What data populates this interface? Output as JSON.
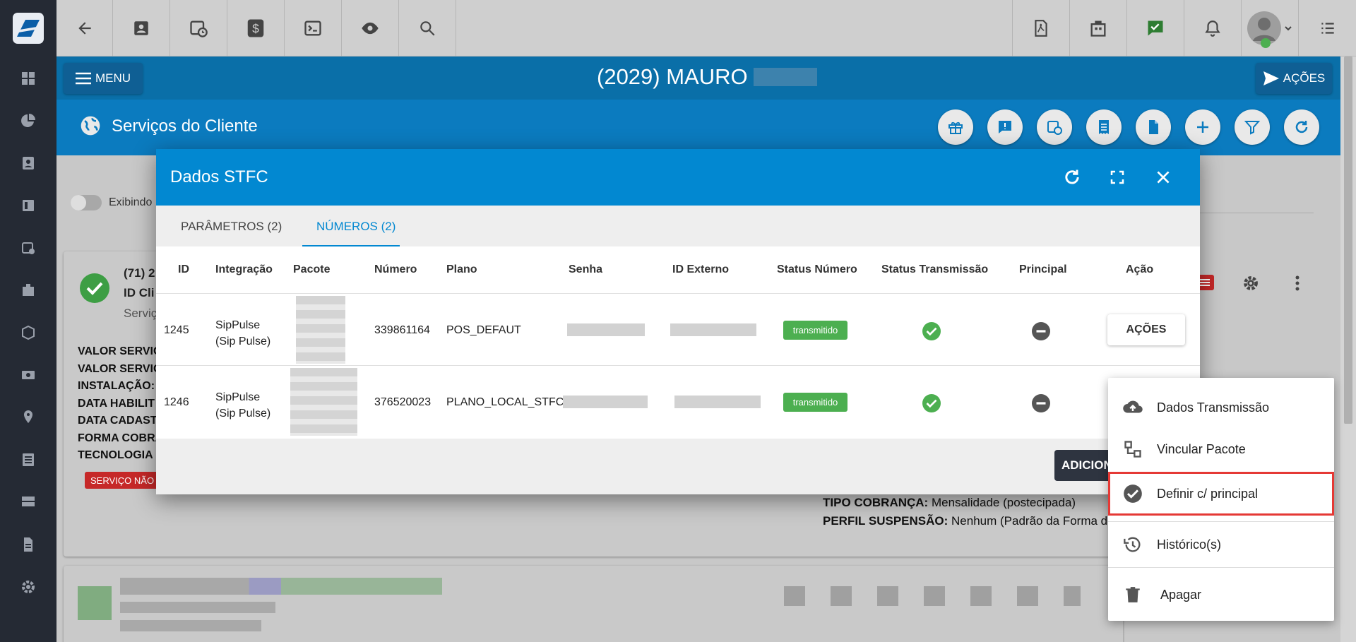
{
  "topbar": {
    "icons": [
      "back-arrow-icon",
      "contact-card-icon",
      "calendar-clock-icon",
      "dollar-icon",
      "terminal-icon",
      "eye-icon",
      "search-icon",
      "pdf-icon",
      "building-icon",
      "chat-check-icon",
      "bell-icon",
      "avatar",
      "list-icon"
    ]
  },
  "header": {
    "menu_label": "MENU",
    "client_title": "(2029) MAURO",
    "acoes_label": "AÇÕES",
    "page_title": "Serviços do Cliente"
  },
  "background": {
    "toggle_label": "Exibindo",
    "service_phone": "(71) 2",
    "id_label": "ID Cli",
    "servico_label": "Serviç",
    "fields": [
      "VALOR SERVIÇ",
      "VALOR SERVIÇ",
      "INSTALAÇÃO:",
      "DATA HABILIT",
      "DATA CADAST",
      "FORMA COBRA",
      "TECNOLOGIA I"
    ],
    "status_badge": "SERVIÇO NÃO I",
    "tipo_cobranca_label": "TIPO COBRANÇA:",
    "tipo_cobranca_value": "Mensalidade (postecipada)",
    "perfil_suspensao_label": "PERFIL SUSPENSÃO:",
    "perfil_suspensao_value": "Nenhum (Padrão da Forma de"
  },
  "modal": {
    "title": "Dados STFC",
    "tabs": [
      {
        "label": "PARÂMETROS (2)",
        "active": false
      },
      {
        "label": "NÚMEROS (2)",
        "active": true
      }
    ],
    "columns": [
      "ID",
      "Integração",
      "Pacote",
      "Número",
      "Plano",
      "Senha",
      "ID Externo",
      "Status Número",
      "Status Transmissão",
      "Principal",
      "Ação"
    ],
    "rows": [
      {
        "id": "1245",
        "integracao": "SipPulse (Sip Pulse)",
        "numero": "339861164",
        "plano": "POS_DEFAUT",
        "status_numero": "transmitido",
        "acao_label": "AÇÕES"
      },
      {
        "id": "1246",
        "integracao": "SipPulse (Sip Pulse)",
        "numero": "376520023",
        "plano": "PLANO_LOCAL_STFC",
        "status_numero": "transmitido"
      }
    ],
    "footer_button": "ADICION"
  },
  "dropdown": {
    "items": [
      {
        "label": "Dados Transmissão",
        "icon": "cloud-upload-icon"
      },
      {
        "label": "Vincular Pacote",
        "icon": "link-package-icon"
      },
      {
        "label": "Definir c/ principal",
        "icon": "check-circle-icon",
        "highlighted": true
      },
      {
        "label": "Histórico(s)",
        "icon": "history-icon"
      },
      {
        "label": "Apagar",
        "icon": "trash-icon"
      }
    ]
  },
  "colors": {
    "header_blue": "#0288d1",
    "sidebar": "#252a34",
    "success_green": "#4caf50",
    "highlight_red": "#e53935",
    "badge_red": "#e53935"
  }
}
